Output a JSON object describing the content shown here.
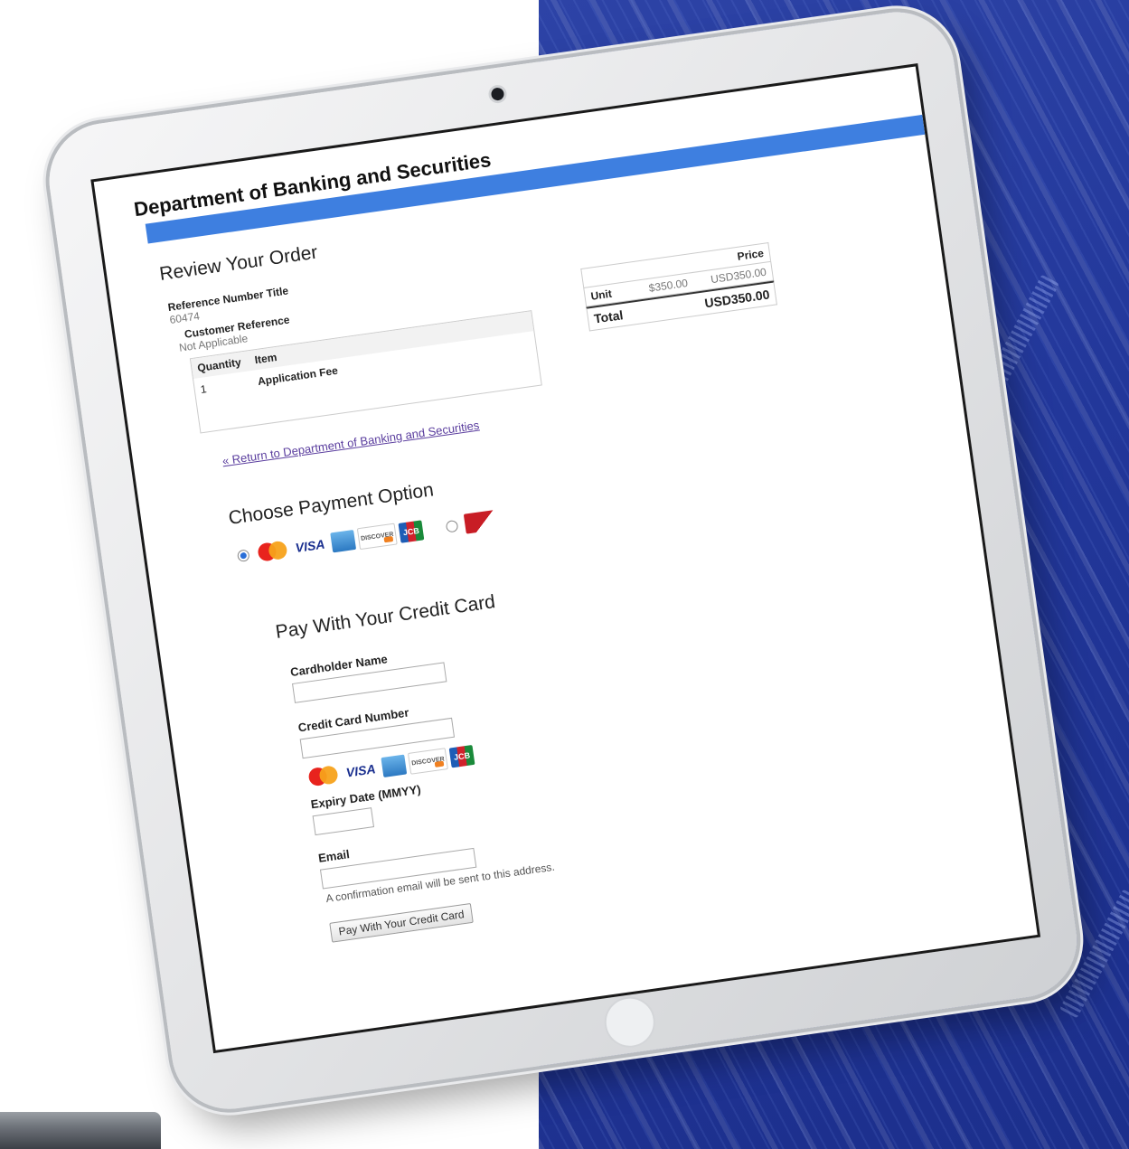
{
  "header": {
    "department": "Department of Banking and Securities"
  },
  "review": {
    "heading": "Review Your Order",
    "reference_label": "Reference Number Title",
    "reference_value": "60474",
    "customer_ref_label": "Customer Reference",
    "customer_ref_value": "Not Applicable",
    "columns": {
      "quantity": "Quantity",
      "item": "Item",
      "unit": "Unit",
      "price": "Price"
    },
    "rows": [
      {
        "quantity": "1",
        "item": "Application Fee",
        "unit": "$350.00",
        "currency": "USD",
        "price": "350.00"
      }
    ],
    "total_label": "Total",
    "total_currency": "USD",
    "total_value": "350.00"
  },
  "return_link": "« Return to Department of Banking and Securities",
  "payment": {
    "heading": "Choose Payment Option",
    "options": [
      {
        "id": "credit-card",
        "selected": true,
        "cards": [
          "mastercard-icon",
          "visa-icon",
          "amex-icon",
          "discover-icon",
          "jcb-icon"
        ]
      },
      {
        "id": "interac",
        "selected": false,
        "cards": [
          "interac-icon"
        ]
      }
    ]
  },
  "credit_card_form": {
    "heading": "Pay With Your Credit Card",
    "cardholder_label": "Cardholder Name",
    "cardholder_value": "",
    "card_number_label": "Credit Card Number",
    "card_number_value": "",
    "expiry_label": "Expiry Date (MMYY)",
    "expiry_value": "",
    "email_label": "Email",
    "email_value": "",
    "email_note": "A confirmation email will be sent to this address.",
    "submit_label": "Pay With Your Credit Card"
  },
  "colors": {
    "header_bar": "#3e7fe0",
    "link": "#5a3d9e",
    "backdrop": "#22379a"
  }
}
